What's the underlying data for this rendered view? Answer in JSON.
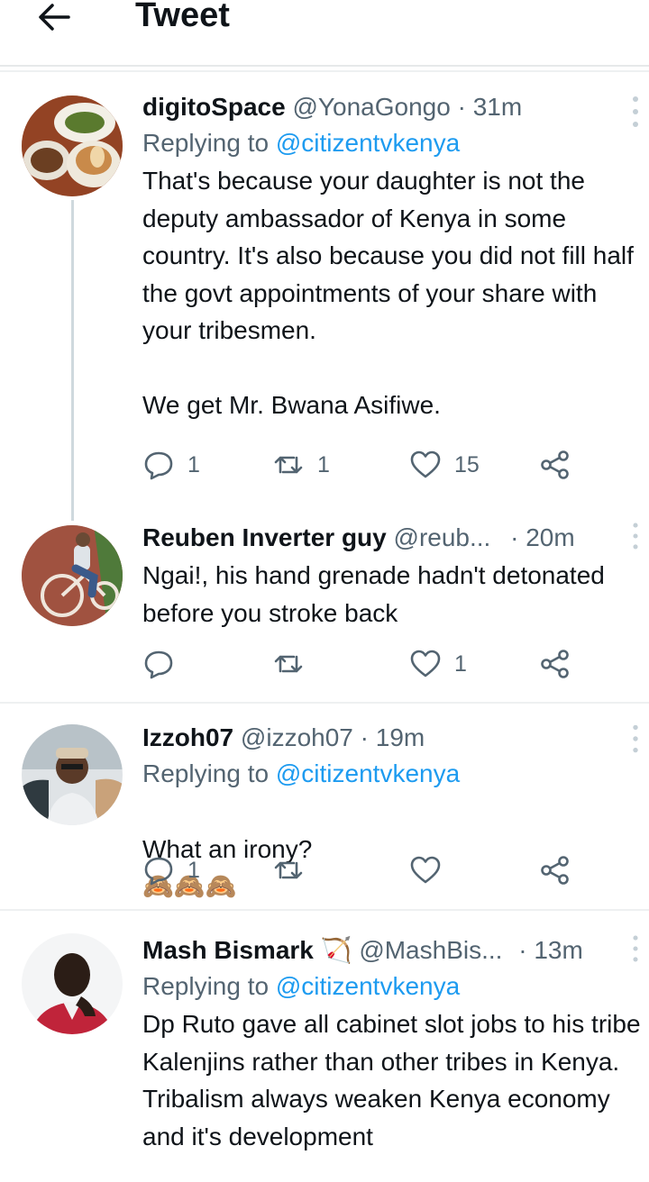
{
  "header": {
    "title": "Tweet"
  },
  "tweets": [
    {
      "name": "digitoSpace",
      "handle": "@YonaGongo",
      "separator": "·",
      "time": "31m",
      "replying_label": "Replying to",
      "replying_to": "@citizentvkenya",
      "text": "That's because your daughter is not the deputy ambassador of Kenya in some country. It's also because you did not fill half the govt appointments of your share with your tribesmen.\n\nWe get Mr. Bwana Asifiwe.",
      "replies": "1",
      "retweets": "1",
      "likes": "15"
    },
    {
      "name": "Reuben Inverter guy",
      "handle": "@reub...",
      "separator": "·",
      "time": "20m",
      "text": "Ngai!, his hand grenade hadn't detonated before you stroke back",
      "replies": "",
      "retweets": "",
      "likes": "1"
    },
    {
      "name": "Izzoh07",
      "handle": "@izzoh07",
      "separator": "·",
      "time": "19m",
      "replying_label": "Replying to",
      "replying_to": "@citizentvkenya",
      "text": "What an irony?",
      "emoji": "🙈🙈🙈",
      "replies": "1",
      "retweets": "",
      "likes": ""
    },
    {
      "name": "Mash Bismark",
      "name_emoji": "🏹",
      "handle": "@MashBis...",
      "separator": "·",
      "time": "13m",
      "replying_label": "Replying to",
      "replying_to": "@citizentvkenya",
      "text": "Dp Ruto gave all cabinet slot jobs to his tribe Kalenjins rather than other tribes in Kenya. Tribalism always weaken Kenya economy and it's development"
    }
  ]
}
